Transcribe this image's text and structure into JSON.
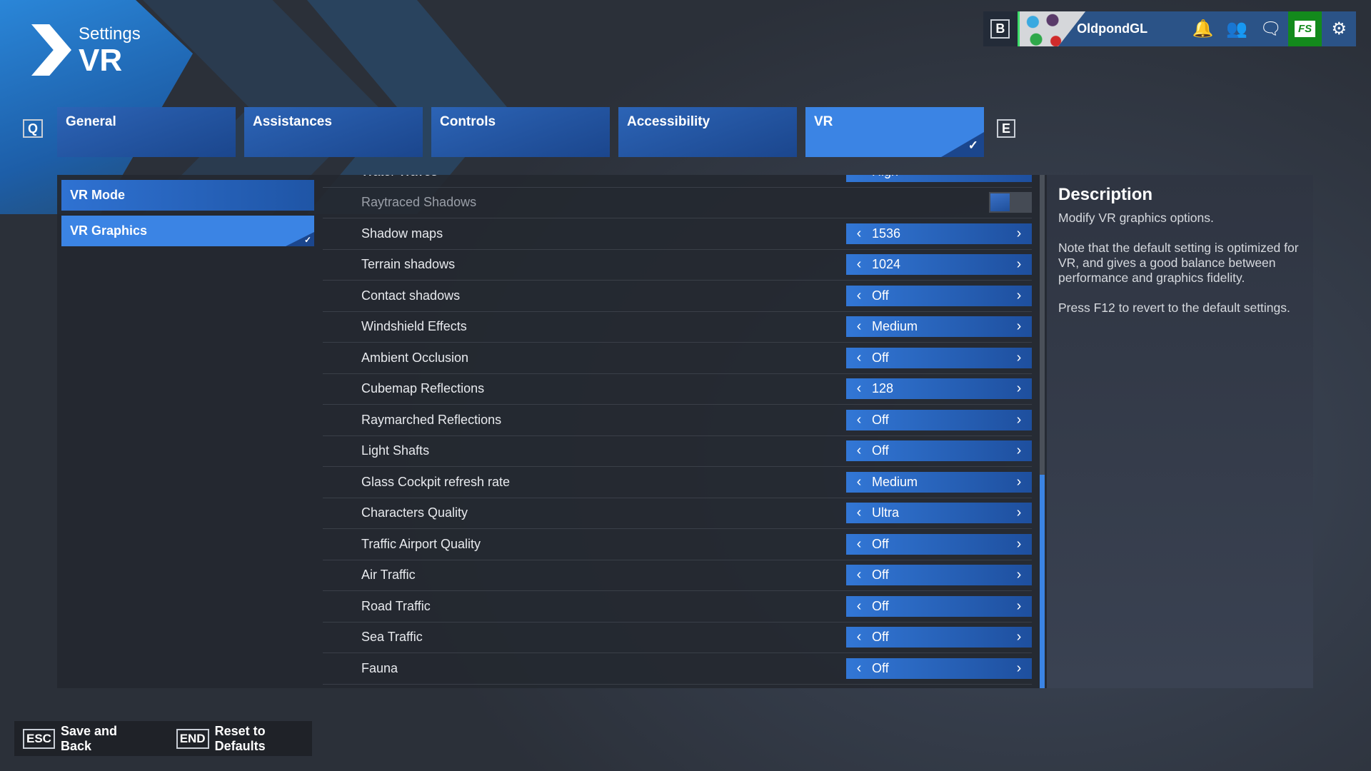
{
  "header": {
    "section": "Settings",
    "title": "VR"
  },
  "topbar": {
    "key": "B",
    "username": "OldpondGL",
    "icons": [
      "bell-icon",
      "friends-icon",
      "chat-icon",
      "store-icon",
      "gear-icon"
    ],
    "store_label": "FS"
  },
  "tabs": {
    "prev_key": "Q",
    "next_key": "E",
    "items": [
      {
        "label": "General"
      },
      {
        "label": "Assistances"
      },
      {
        "label": "Controls"
      },
      {
        "label": "Accessibility"
      },
      {
        "label": "VR",
        "active": true
      }
    ]
  },
  "sidebar": {
    "items": [
      {
        "label": "VR Mode"
      },
      {
        "label": "VR Graphics",
        "active": true
      }
    ]
  },
  "settings": [
    {
      "label": "Water Waves",
      "value": "High"
    },
    {
      "label": "Raytraced Shadows",
      "toggle": false,
      "disabled": true
    },
    {
      "label": "Shadow maps",
      "value": "1536"
    },
    {
      "label": "Terrain shadows",
      "value": "1024"
    },
    {
      "label": "Contact shadows",
      "value": "Off"
    },
    {
      "label": "Windshield Effects",
      "value": "Medium"
    },
    {
      "label": "Ambient Occlusion",
      "value": "Off"
    },
    {
      "label": "Cubemap Reflections",
      "value": "128"
    },
    {
      "label": "Raymarched Reflections",
      "value": "Off"
    },
    {
      "label": "Light Shafts",
      "value": "Off"
    },
    {
      "label": "Glass Cockpit refresh rate",
      "value": "Medium"
    },
    {
      "label": "Characters Quality",
      "value": "Ultra"
    },
    {
      "label": "Traffic Airport Quality",
      "value": "Off"
    },
    {
      "label": "Air Traffic",
      "value": "Off"
    },
    {
      "label": "Road Traffic",
      "value": "Off"
    },
    {
      "label": "Sea Traffic",
      "value": "Off"
    },
    {
      "label": "Fauna",
      "value": "Off"
    }
  ],
  "scroll_position_percent": 100,
  "description": {
    "title": "Description",
    "paragraphs": [
      "Modify VR graphics options.",
      "Note that the default setting is optimized for VR, and gives a good balance between performance and graphics fidelity.",
      "Press F12 to revert to the default settings."
    ]
  },
  "footer": {
    "save_key": "ESC",
    "save_label": "Save and Back",
    "reset_key": "END",
    "reset_label": "Reset to Defaults"
  },
  "colors": {
    "accent": "#3b84e4",
    "tab": "#1f55a6",
    "store": "#138a1c"
  }
}
